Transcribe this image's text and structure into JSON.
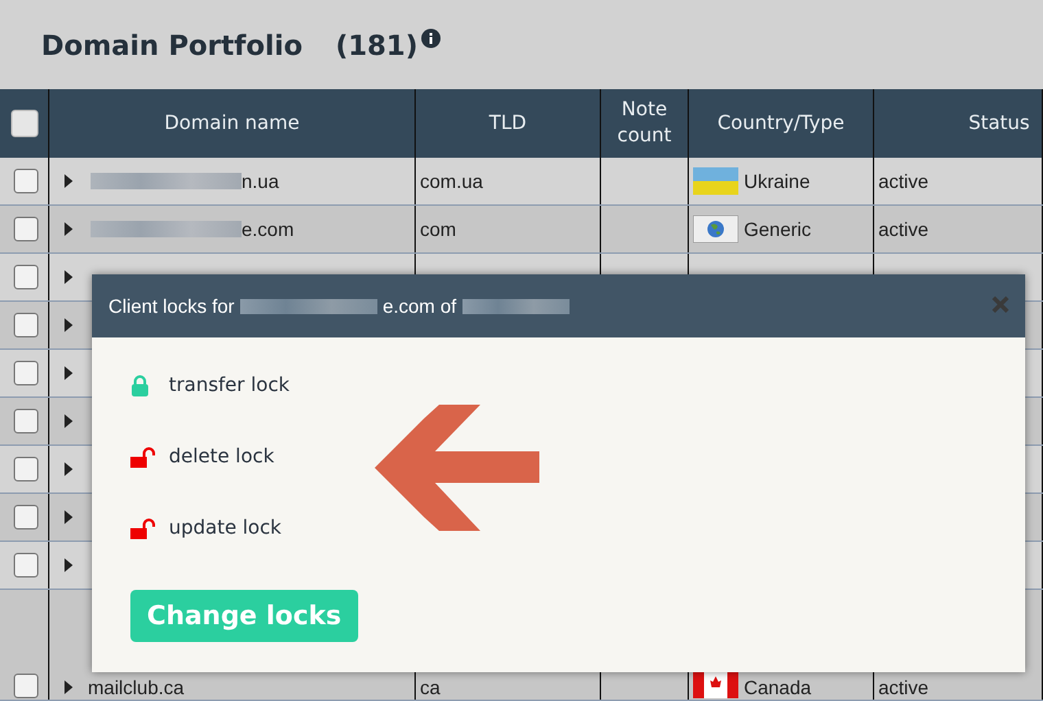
{
  "page": {
    "title": "Domain Portfolio",
    "count": "(181)"
  },
  "table": {
    "all_checked": false,
    "columns": [
      "Domain name",
      "TLD",
      "Note count",
      "Country/Type",
      "Status"
    ],
    "rows": [
      {
        "checked": false,
        "expanded": false,
        "domain": "n.ua",
        "tld": "com.ua",
        "country": "Ukraine",
        "flag": {
          "kind": "ukraine"
        },
        "status": "active",
        "redacted": true
      },
      {
        "checked": false,
        "expanded": false,
        "domain": "e.com",
        "tld": "com",
        "country": "Generic",
        "flag": {
          "kind": "globe"
        },
        "status": "active",
        "redacted": true
      },
      {
        "checked": false,
        "expanded": false
      },
      {
        "checked": false,
        "expanded": false
      },
      {
        "checked": false,
        "expanded": false
      },
      {
        "checked": false,
        "expanded": false
      },
      {
        "checked": false,
        "expanded": false
      },
      {
        "checked": false,
        "expanded": false
      },
      {
        "checked": false,
        "expanded": false
      },
      {
        "checked": false,
        "expanded": false,
        "domain": "mailclub.ca",
        "tld": "ca",
        "country": "Canada",
        "flag": {
          "kind": "canada"
        },
        "status": "active"
      }
    ]
  },
  "dialog": {
    "title_start": "Client locks for",
    "title_domain": "e.com of",
    "locks": [
      {
        "label": "transfer lock",
        "locked": true
      },
      {
        "label": "delete lock",
        "locked": false
      },
      {
        "label": "update lock",
        "locked": false
      }
    ],
    "button": "Change locks"
  }
}
